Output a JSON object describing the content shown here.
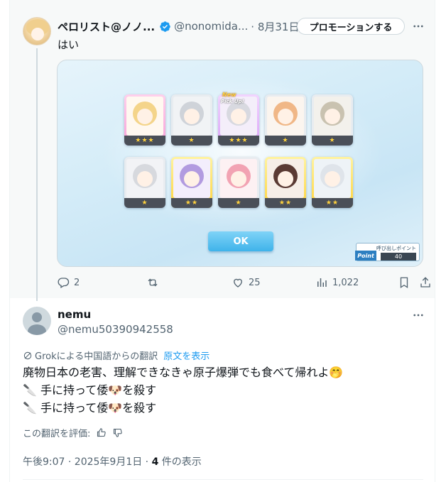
{
  "tweet1": {
    "display_name": "ペロリスト@ノノ...",
    "handle": "@nonomida...",
    "date": "· 8月31日",
    "promote_label": "プロモーションする",
    "text": "はい",
    "media": {
      "ok_label": "OK",
      "point_caption": "呼び出しポイント",
      "point_tag": "Point",
      "point_value": "40",
      "new_label": "New",
      "pickup_label": "Pick Up!",
      "cards": [
        {
          "stars": "★★★",
          "frame": "pink"
        },
        {
          "stars": "★",
          "frame": "silver"
        },
        {
          "stars": "★★★",
          "frame": "purple"
        },
        {
          "stars": "★",
          "frame": "silver"
        },
        {
          "stars": "★",
          "frame": "silver"
        },
        {
          "stars": "★",
          "frame": "silver"
        },
        {
          "stars": "★★",
          "frame": "gold"
        },
        {
          "stars": "★",
          "frame": "silver"
        },
        {
          "stars": "★★",
          "frame": "gold"
        },
        {
          "stars": "★★",
          "frame": "gold"
        }
      ]
    },
    "stats": {
      "replies": "2",
      "likes": "25",
      "views": "1,022"
    }
  },
  "tweet2": {
    "display_name": "nemu",
    "handle": "@nemu50390942558",
    "translation_note": "Grokによる中国語からの翻訳",
    "show_original": "原文を表示",
    "lines": [
      "廃物日本の老害、理解できなきゃ原子爆弾でも食べて帰れよ🤭",
      "🔪 手に持って倭🐶を殺す",
      "🔪 手に持って倭🐶を殺す"
    ],
    "rate_label": "この翻訳を評価:",
    "timestamp": "午後9:07 · 2025年9月1日 · ",
    "views_count": "4",
    "views_suffix": " 件の表示"
  },
  "colors": {
    "accent": "#1d9bf0",
    "muted": "#536471",
    "text": "#0f1419",
    "card_star": "#ffd23c"
  }
}
